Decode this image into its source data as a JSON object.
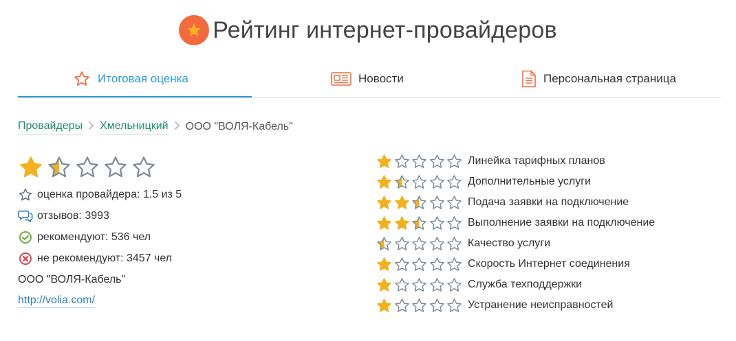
{
  "header": {
    "title": "Рейтинг интернет-провайдеров",
    "logo_icon": "star-badge-icon"
  },
  "tabs": [
    {
      "label": "Итоговая оценка",
      "icon": "star-outline-icon",
      "active": true
    },
    {
      "label": "Новости",
      "icon": "newspaper-icon",
      "active": false
    },
    {
      "label": "Персональная страница",
      "icon": "document-icon",
      "active": false
    }
  ],
  "breadcrumb": {
    "items": [
      "Провайдеры",
      "Хмельницкий"
    ],
    "current": "ООО \"ВОЛЯ-Кабель\""
  },
  "summary": {
    "overall_rating": 1.5,
    "rating_text": "оценка провайдера: 1.5 из 5",
    "reviews_text": "отзывов: 3993",
    "recommend_text": "рекомендуют: 536 чел",
    "not_recommend_text": "не рекомендуют: 3457 чел",
    "company_name": "ООО \"ВОЛЯ-Кабель\"",
    "website": "http://volia.com/"
  },
  "criteria": [
    {
      "label": "Линейка тарифных планов",
      "rating": 1
    },
    {
      "label": "Дополнительные услуги",
      "rating": 1.5
    },
    {
      "label": "Подача заявки на подключение",
      "rating": 2.5
    },
    {
      "label": "Выполнение заявки на подключение",
      "rating": 2.5
    },
    {
      "label": "Качество услуги",
      "rating": 0.5
    },
    {
      "label": "Скорость Интернет соединения",
      "rating": 1
    },
    {
      "label": "Служба техподдержки",
      "rating": 1
    },
    {
      "label": "Устранение неисправностей",
      "rating": 1
    }
  ],
  "colors": {
    "accent_blue": "#2b9ad6",
    "accent_orange": "#f26a3d",
    "star_gold": "#f2b21f",
    "star_outline": "#7d8a99",
    "link_green": "#1f8a70",
    "ok_green": "#6cb23e",
    "bad_red": "#e0434b"
  }
}
